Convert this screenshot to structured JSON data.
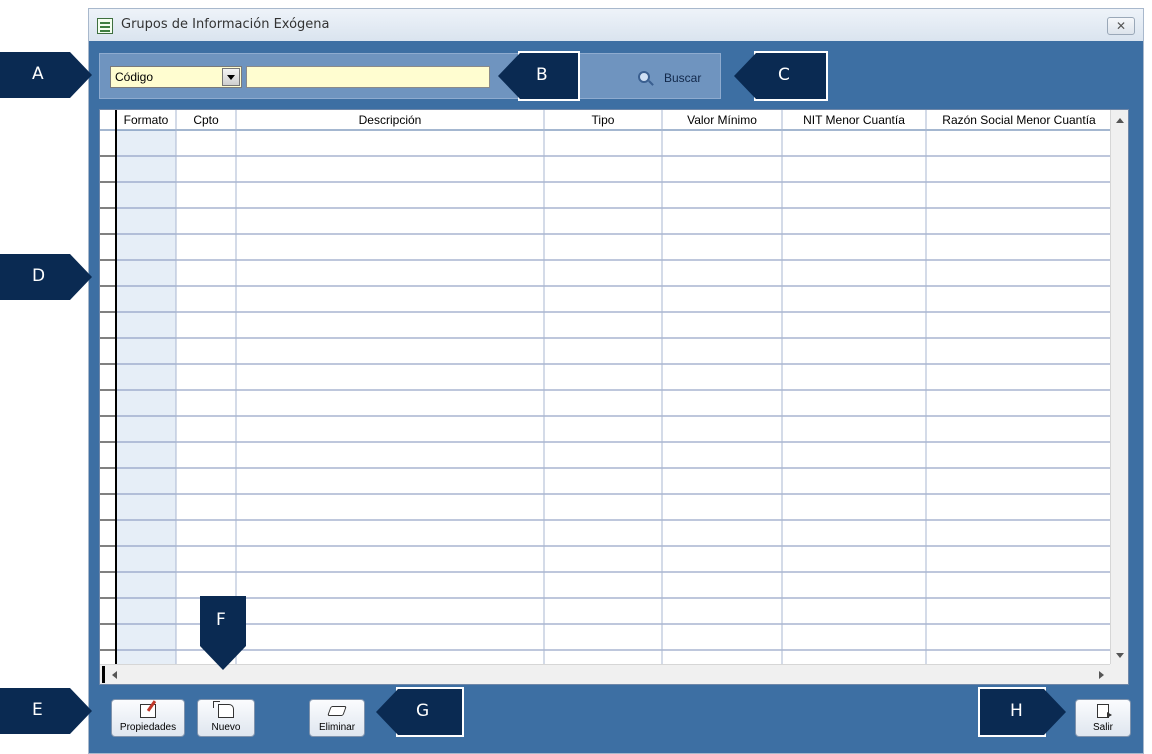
{
  "window": {
    "title": "Grupos de Información Exógena",
    "close_symbol": "✕"
  },
  "search": {
    "field_option": "Código",
    "query_value": "",
    "button_label": "Buscar"
  },
  "grid": {
    "columns": [
      "Formato",
      "Cpto",
      "Descripción",
      "Tipo",
      "Valor Mínimo",
      "NIT Menor Cuantía",
      "Razón Social Menor Cuantía"
    ],
    "rows": [],
    "visible_empty_rows": 20
  },
  "toolbar": {
    "properties_label": "Propiedades",
    "new_label": "Nuevo",
    "delete_label": "Eliminar",
    "exit_label": "Salir"
  },
  "callouts": {
    "a": "A",
    "b": "B",
    "c": "C",
    "d": "D",
    "e": "E",
    "f": "F",
    "g": "G",
    "h": "H"
  },
  "icons": {
    "window_icon": "document-icon",
    "search_icon": "magnifier-icon",
    "properties_icon": "edit-icon",
    "new_icon": "new-document-icon",
    "delete_icon": "eraser-icon",
    "exit_icon": "exit-door-icon"
  },
  "colors": {
    "panel_blue": "#3d6fa3",
    "input_yellow": "#fffdd0",
    "callout_navy": "#0a2a52",
    "frozen_column": "#e6eef7"
  }
}
